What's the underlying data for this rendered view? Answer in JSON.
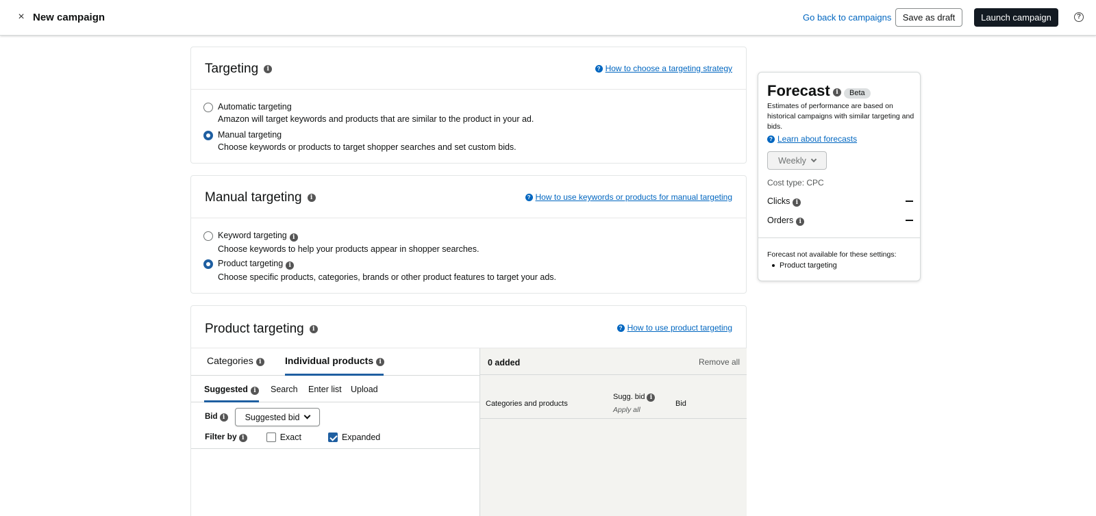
{
  "header": {
    "close_icon": "×",
    "title": "New campaign",
    "back_link": "Go back to campaigns",
    "save_draft": "Save as draft",
    "launch": "Launch campaign",
    "help_icon": "?"
  },
  "targeting": {
    "title": "Targeting",
    "help_link": "How to choose a targeting strategy",
    "options": [
      {
        "label": "Automatic targeting",
        "desc": "Amazon will target keywords and products that are similar to the product in your ad.",
        "selected": false
      },
      {
        "label": "Manual targeting",
        "desc": "Choose keywords or products to target shopper searches and set custom bids.",
        "selected": true
      }
    ]
  },
  "manual_targeting": {
    "title": "Manual targeting",
    "help_link": "How to use keywords or products for manual targeting",
    "options": [
      {
        "label": "Keyword targeting",
        "desc": "Choose keywords to help your products appear in shopper searches.",
        "selected": false
      },
      {
        "label": "Product targeting",
        "desc": "Choose specific products, categories, brands or other product features to target your ads.",
        "selected": true
      }
    ]
  },
  "product_targeting": {
    "title": "Product targeting",
    "help_link": "How to use product targeting",
    "tabs": [
      "Categories",
      "Individual products"
    ],
    "active_tab": "Individual products",
    "sub_tabs": [
      "Suggested",
      "Search",
      "Enter list",
      "Upload"
    ],
    "active_sub_tab": "Suggested",
    "bid_label": "Bid",
    "bid_select": "Suggested bid",
    "filter_label": "Filter by",
    "filters": [
      {
        "label": "Exact",
        "checked": false
      },
      {
        "label": "Expanded",
        "checked": true
      }
    ],
    "added": "0 added",
    "remove_all": "Remove all",
    "columns": {
      "col1": "Categories and products",
      "col2": "Sugg. bid",
      "col2_sub": "Apply all",
      "col3": "Bid"
    }
  },
  "forecast": {
    "title": "Forecast",
    "badge": "Beta",
    "desc": "Estimates of performance are based on historical campaigns with similar targeting and bids.",
    "learn_link": "Learn about forecasts",
    "period": "Weekly",
    "cost_type": "Cost type: CPC",
    "metrics": [
      "Clicks",
      "Orders"
    ],
    "na_text": "Forecast not available for these settings:",
    "na_items": [
      "Product targeting"
    ]
  }
}
